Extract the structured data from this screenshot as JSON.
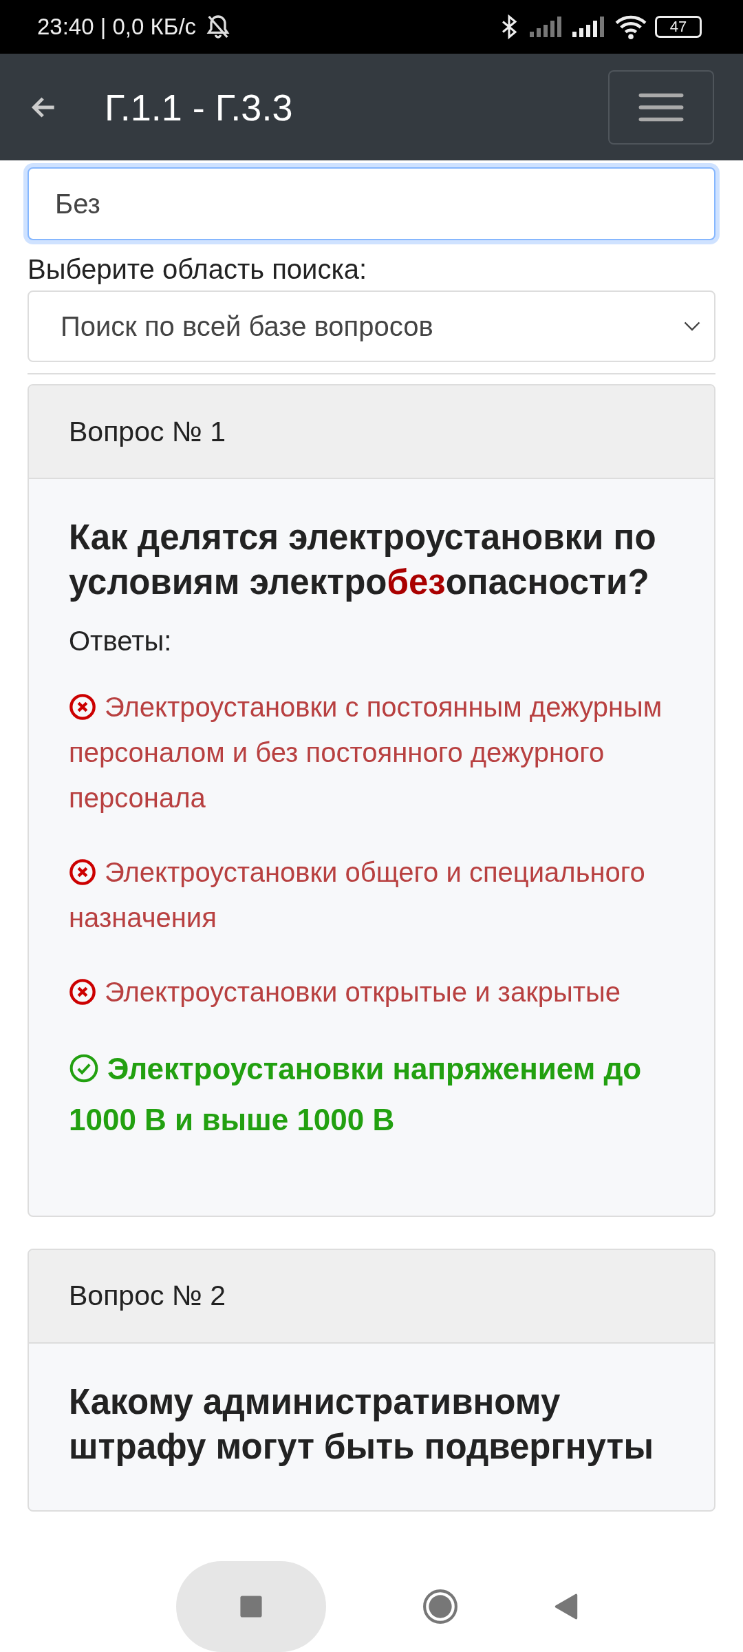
{
  "status_bar": {
    "time": "23:40 | 0,0 КБ/с",
    "battery": "47"
  },
  "app_bar": {
    "title": "Г.1.1 - Г.3.3"
  },
  "search": {
    "value": "Без",
    "focused": true
  },
  "scope": {
    "label": "Выберите область поиска:",
    "value": "Поиск по всей базе вопросов"
  },
  "questions": [
    {
      "header": "Вопрос № 1",
      "text": "Как делятся электроустановки по условиям электро**без**опасности?",
      "answers_label": "Ответы:",
      "answers": [
        {
          "text": "Электроустановки с постоянным дежурным персоналом и без постоянного дежурного персонала",
          "correct": false
        },
        {
          "text": "Электроустановки общего и специального назначения",
          "correct": false
        },
        {
          "text": "Электроустановки открытые и закрытые",
          "correct": false
        },
        {
          "text": "Электроустановки напряжением до 1000 В и выше 1000 В",
          "correct": true
        }
      ]
    },
    {
      "header": "Вопрос № 2",
      "text": "Какому административному штрафу могут быть подвергнуты"
    }
  ]
}
